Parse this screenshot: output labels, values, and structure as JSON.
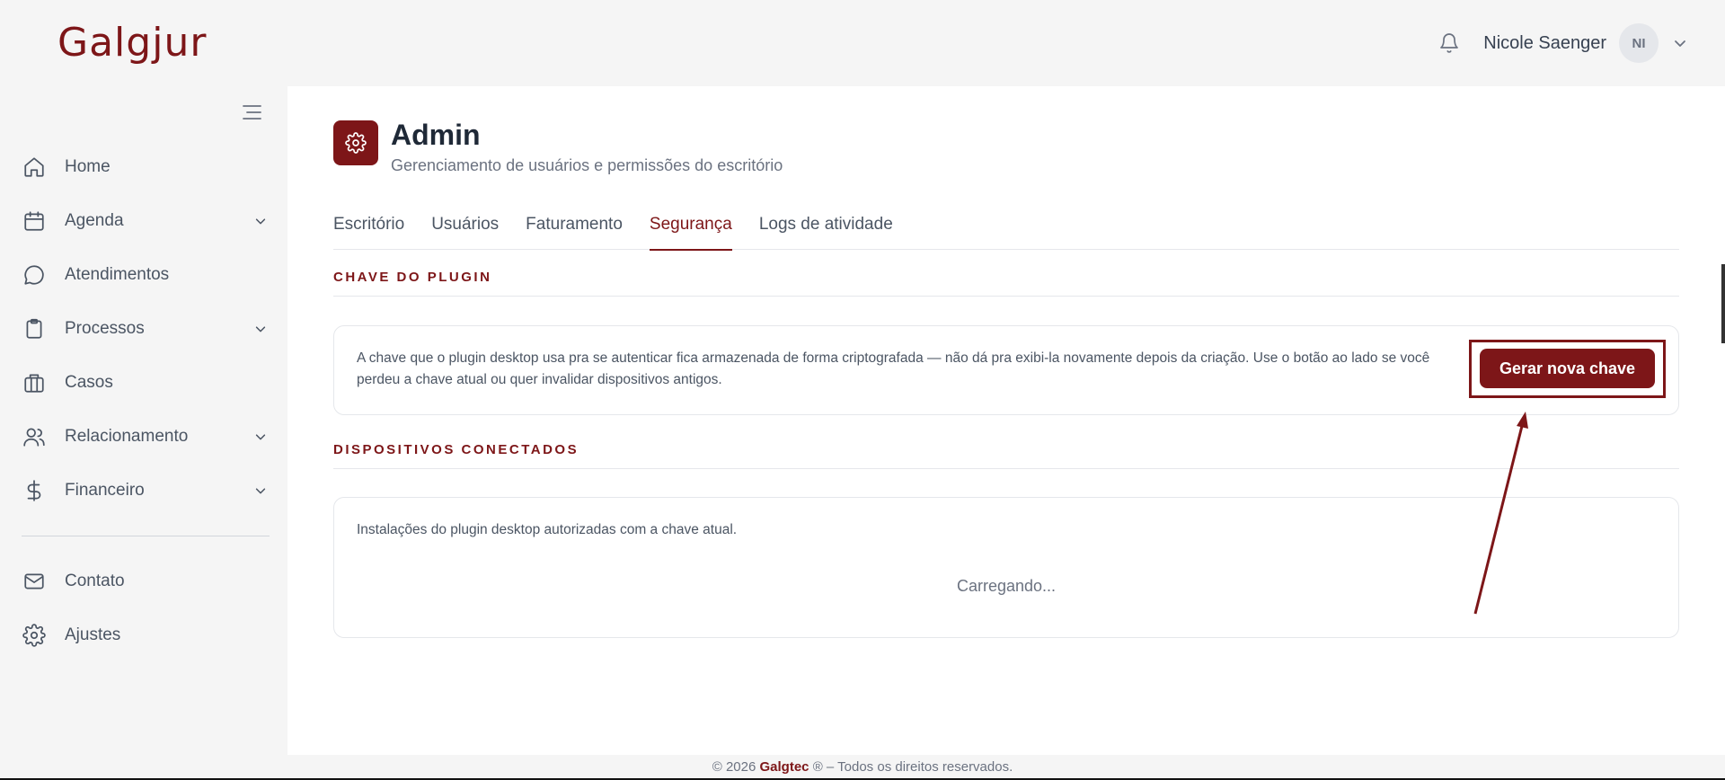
{
  "app": {
    "logo": "Galgjur"
  },
  "header": {
    "user_name": "Nicole Saenger",
    "avatar_initials": "NI"
  },
  "sidebar": {
    "items": [
      {
        "label": "Home",
        "icon": "home-icon",
        "has_chevron": false
      },
      {
        "label": "Agenda",
        "icon": "calendar-icon",
        "has_chevron": true
      },
      {
        "label": "Atendimentos",
        "icon": "chat-bubble-icon",
        "has_chevron": false
      },
      {
        "label": "Processos",
        "icon": "clipboard-icon",
        "has_chevron": true
      },
      {
        "label": "Casos",
        "icon": "briefcase-icon",
        "has_chevron": false
      },
      {
        "label": "Relacionamento",
        "icon": "users-icon",
        "has_chevron": true
      },
      {
        "label": "Financeiro",
        "icon": "dollar-icon",
        "has_chevron": true
      }
    ],
    "bottom_items": [
      {
        "label": "Contato",
        "icon": "mail-icon"
      },
      {
        "label": "Ajustes",
        "icon": "gear-icon"
      }
    ]
  },
  "page": {
    "title": "Admin",
    "subtitle": "Gerenciamento de usuários e permissões do escritório",
    "tabs": [
      {
        "label": "Escritório",
        "active": false
      },
      {
        "label": "Usuários",
        "active": false
      },
      {
        "label": "Faturamento",
        "active": false
      },
      {
        "label": "Segurança",
        "active": true
      },
      {
        "label": "Logs de atividade",
        "active": false
      }
    ]
  },
  "plugin_key": {
    "heading": "CHAVE DO PLUGIN",
    "description": "A chave que o plugin desktop usa pra se autenticar fica armazenada de forma criptografada — não dá pra exibi-la novamente depois da criação. Use o botão ao lado se você perdeu a chave atual ou quer invalidar dispositivos antigos.",
    "button_label": "Gerar nova chave"
  },
  "devices": {
    "heading": "DISPOSITIVOS CONECTADOS",
    "description": "Instalações do plugin desktop autorizadas com a chave atual.",
    "loading_text": "Carregando..."
  },
  "footer": {
    "prefix": "© 2026 ",
    "brand": "Galgtec",
    "suffix": " ® – Todos os direitos reservados."
  },
  "colors": {
    "brand": "#7d1618",
    "background": "#f5f5f5",
    "panel": "#ffffff"
  }
}
